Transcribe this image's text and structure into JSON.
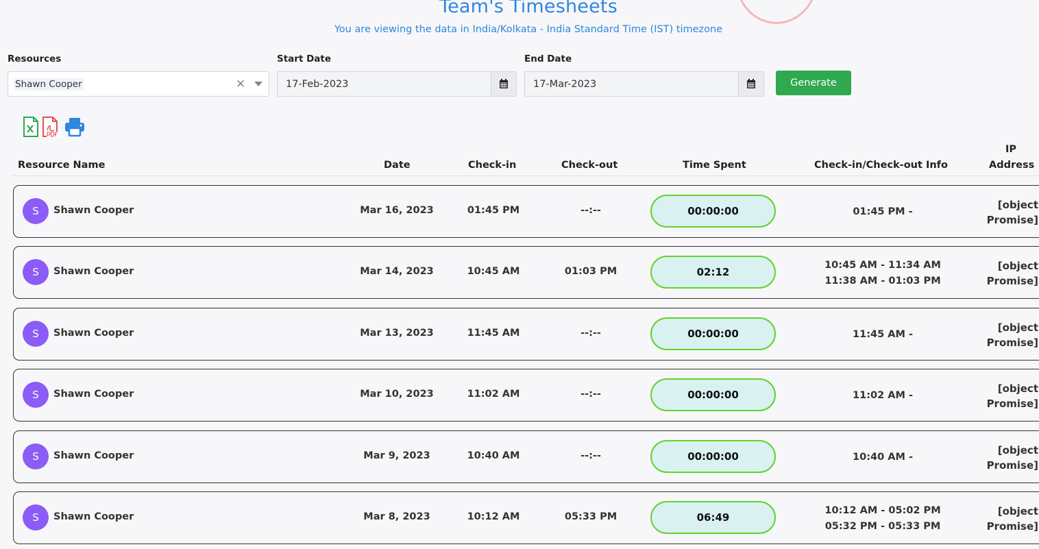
{
  "header": {
    "title": "Team's Timesheets",
    "subtitle": "You are viewing the data in India/Kolkata - India Standard Time (IST) timezone"
  },
  "filters": {
    "resources_label": "Resources",
    "resources_value": "Shawn Cooper",
    "start_label": "Start Date",
    "start_value": "17-Feb-2023",
    "end_label": "End Date",
    "end_value": "17-Mar-2023",
    "generate_label": "Generate"
  },
  "export_icons": [
    "excel-icon",
    "pdf-icon",
    "printer-icon"
  ],
  "columns": {
    "resource_name": "Resource Name",
    "date": "Date",
    "check_in": "Check-in",
    "check_out": "Check-out",
    "time_spent": "Time Spent",
    "info": "Check-in/Check-out Info",
    "ip_line1": "IP",
    "ip_line2": "Address"
  },
  "rows": [
    {
      "initial": "S",
      "name": "Shawn Cooper",
      "date": "Mar 16, 2023",
      "check_in": "01:45 PM",
      "check_out": "--:--",
      "time_spent": "00:00:00",
      "info1": "01:45 PM -",
      "info2": "",
      "ip1": "[object",
      "ip2": "Promise]"
    },
    {
      "initial": "S",
      "name": "Shawn Cooper",
      "date": "Mar 14, 2023",
      "check_in": "10:45 AM",
      "check_out": "01:03 PM",
      "time_spent": "02:12",
      "info1": "10:45 AM - 11:34 AM",
      "info2": "11:38 AM - 01:03 PM",
      "ip1": "[object",
      "ip2": "Promise]"
    },
    {
      "initial": "S",
      "name": "Shawn Cooper",
      "date": "Mar 13, 2023",
      "check_in": "11:45 AM",
      "check_out": "--:--",
      "time_spent": "00:00:00",
      "info1": "11:45 AM -",
      "info2": "",
      "ip1": "[object",
      "ip2": "Promise]"
    },
    {
      "initial": "S",
      "name": "Shawn Cooper",
      "date": "Mar 10, 2023",
      "check_in": "11:02 AM",
      "check_out": "--:--",
      "time_spent": "00:00:00",
      "info1": "11:02 AM -",
      "info2": "",
      "ip1": "[object",
      "ip2": "Promise]"
    },
    {
      "initial": "S",
      "name": "Shawn Cooper",
      "date": "Mar 9, 2023",
      "check_in": "10:40 AM",
      "check_out": "--:--",
      "time_spent": "00:00:00",
      "info1": "10:40 AM -",
      "info2": "",
      "ip1": "[object",
      "ip2": "Promise]"
    },
    {
      "initial": "S",
      "name": "Shawn Cooper",
      "date": "Mar 8, 2023",
      "check_in": "10:12 AM",
      "check_out": "05:33 PM",
      "time_spent": "06:49",
      "info1": "10:12 AM - 05:02 PM",
      "info2": "05:32 PM - 05:33 PM",
      "ip1": "[object",
      "ip2": "Promise]"
    }
  ],
  "colors": {
    "accent": "#2e86de",
    "generate": "#2fa84f",
    "avatar": "#8b5cf6",
    "pill_border": "#5fd32a",
    "pill_fill": "#d9f2f1"
  }
}
